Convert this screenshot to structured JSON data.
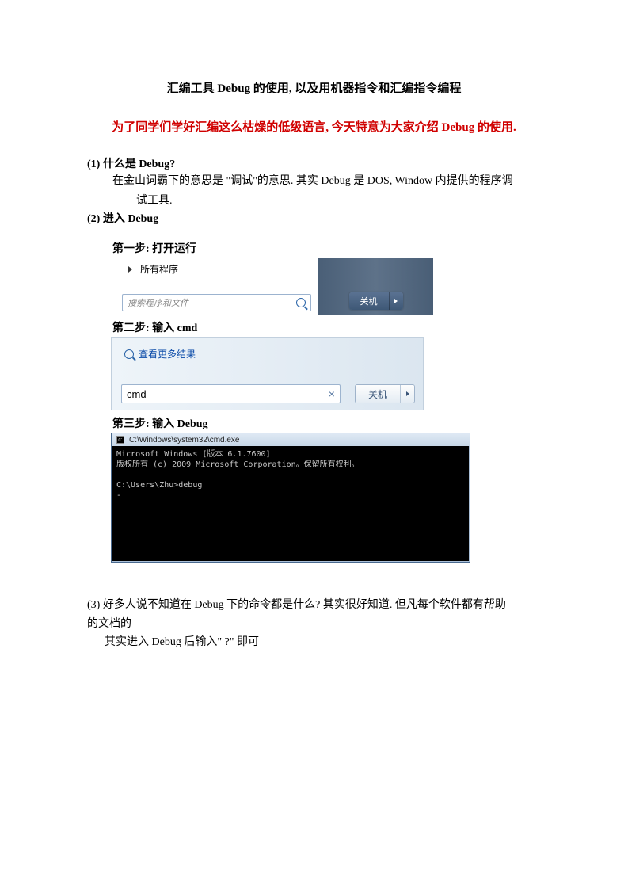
{
  "title": "汇编工具 Debug 的使用,  以及用机器指令和汇编指令编程",
  "intro": "为了同学们学好汇编这么枯燥的低级语言,  今天特意为大家介绍 Debug 的使用.",
  "sec1": {
    "heading": "(1)    什么是 Debug?",
    "line1": "在金山词霸下的意思是  \"调试\"的意思.  其实 Debug 是 DOS, Window  内提供的程序调",
    "line2": "试工具."
  },
  "sec2": {
    "heading": "(2)    进入 Debug",
    "step1": "第一步:  打开运行",
    "step2": "第二步:  输入 cmd",
    "step3": "第三步:  输入 Debug"
  },
  "shot1": {
    "all_programs": "所有程序",
    "search_placeholder": "搜索程序和文件",
    "shutdown": "关机"
  },
  "shot2": {
    "more_results": "查看更多结果",
    "cmd_value": "cmd",
    "clear": "×",
    "shutdown": "关机"
  },
  "shot3": {
    "title": "C:\\Windows\\system32\\cmd.exe",
    "line1": "Microsoft Windows [版本 6.1.7600]",
    "line2": "版权所有 (c) 2009 Microsoft Corporation。保留所有权利。",
    "line3": "",
    "line4": "C:\\Users\\Zhu>debug",
    "line5": "-"
  },
  "sec3": {
    "line1": "(3)  好多人说不知道在 Debug  下的命令都是什么?    其实很好知道. 但凡每个软件都有帮助",
    "line2": "的文档的",
    "line3": "其实进入 Debug 后输入\"  ?\"  即可"
  }
}
